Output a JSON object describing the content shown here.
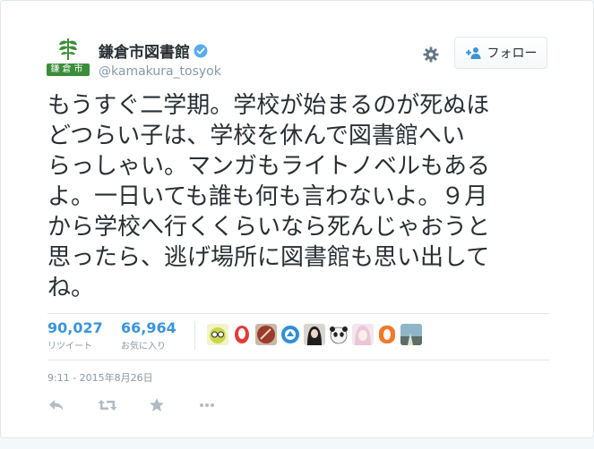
{
  "account": {
    "display_name": "鎌倉市図書館",
    "screen_name": "@kamakura_tosyok",
    "avatar_seal_text": "鎌倉市",
    "verified": true
  },
  "follow_button": {
    "label": "フォロー"
  },
  "tweet": {
    "text": "もうすぐ二学期。学校が始まるのが死ぬほ\nどつらい子は、学校を休んで図書館へい\nらっしゃい。マンガもライトノベルもある\nよ。一日いても誰も何も言わないよ。９月\nから学校へ行くくらいなら死んじゃおうと\n思ったら、逃げ場所に図書館も思い出して\nね。"
  },
  "stats": {
    "retweets": {
      "count": "90,027",
      "label": "リツイート"
    },
    "favorites": {
      "count": "66,964",
      "label": "お気に入り"
    }
  },
  "timestamp": "9:11 - 2015年8月26日",
  "colors": {
    "text": "#292f33",
    "muted": "#8899a6",
    "accent": "#3b94d9",
    "verified": "#55acee",
    "seal": "#3c8d3a"
  },
  "icons": {
    "gear": "gear-icon",
    "follow": "person-add-icon",
    "reply": "reply-icon",
    "retweet": "retweet-icon",
    "favorite": "star-icon",
    "more": "more-icon"
  }
}
